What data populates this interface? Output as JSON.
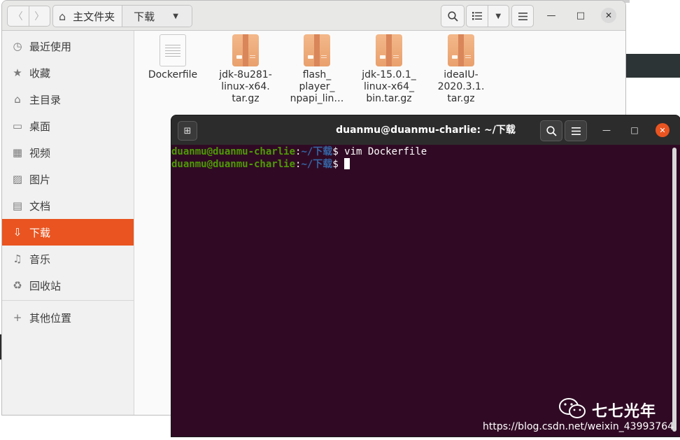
{
  "file_manager": {
    "path": {
      "home_label": "主文件夹",
      "current_label": "下载"
    },
    "sidebar": {
      "items": [
        {
          "label": "最近使用",
          "icon": "clock-icon",
          "glyph": "◷"
        },
        {
          "label": "收藏",
          "icon": "star-icon",
          "glyph": "★"
        },
        {
          "label": "主目录",
          "icon": "home-icon",
          "glyph": "⌂"
        },
        {
          "label": "桌面",
          "icon": "desktop-icon",
          "glyph": "▭"
        },
        {
          "label": "视频",
          "icon": "video-icon",
          "glyph": "▦"
        },
        {
          "label": "图片",
          "icon": "picture-icon",
          "glyph": "▨"
        },
        {
          "label": "文档",
          "icon": "document-icon",
          "glyph": "▤"
        },
        {
          "label": "下载",
          "icon": "download-icon",
          "glyph": "⇩",
          "active": true
        },
        {
          "label": "音乐",
          "icon": "music-icon",
          "glyph": "♫"
        },
        {
          "label": "回收站",
          "icon": "trash-icon",
          "glyph": "♻"
        },
        {
          "label": "其他位置",
          "icon": "plus-icon",
          "glyph": "+"
        }
      ]
    },
    "files": [
      {
        "name_lines": [
          "Dockerfile"
        ],
        "type": "text"
      },
      {
        "name_lines": [
          "jdk-8u281-",
          "linux-x64.",
          "tar.gz"
        ],
        "type": "archive"
      },
      {
        "name_lines": [
          "flash_",
          "player_",
          "npapi_lin…"
        ],
        "type": "archive"
      },
      {
        "name_lines": [
          "jdk-15.0.1_",
          "linux-x64_",
          "bin.tar.gz"
        ],
        "type": "archive"
      },
      {
        "name_lines": [
          "ideaIU-",
          "2020.3.1.",
          "tar.gz"
        ],
        "type": "archive"
      }
    ]
  },
  "terminal": {
    "title": "duanmu@duanmu-charlie: ~/下载",
    "lines": [
      {
        "user": "duanmu@duanmu-charlie",
        "sep": ":",
        "path": "~/下载",
        "prompt": "$ ",
        "command": "vim Dockerfile"
      },
      {
        "user": "duanmu@duanmu-charlie",
        "sep": ":",
        "path": "~/下载",
        "prompt": "$ ",
        "command": ""
      }
    ]
  },
  "watermark": {
    "name": "七七光年",
    "url": "https://blog.csdn.net/weixin_43993764"
  },
  "colors": {
    "accent": "#e95420",
    "terminal_bg": "#300a24",
    "prompt_user": "#4e9a06",
    "prompt_path": "#3465a4"
  }
}
